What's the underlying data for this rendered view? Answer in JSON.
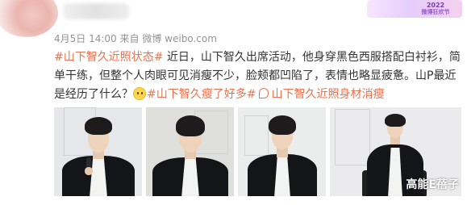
{
  "header": {
    "badge_line1": "2022",
    "badge_line2": "微博狂欢节"
  },
  "meta": {
    "date": "4月5日",
    "time": "14:00",
    "source": "来自 微博 weibo.com"
  },
  "post": {
    "tag_main": "#山下智久近照状态#",
    "text_part1": " 近日，山下智久出席活动，他身穿黑色西服搭配白衬衫，简",
    "text_line2": "单干练，但整个人肉眼可见消瘦不少，脸颊都凹陷了，表情也略显疲惫。山P最近",
    "text_line3_start": "是经历了什么？",
    "tag_thin": "#山下智久瘦了好多#",
    "topic_link": "山下智久近照身材消瘦"
  },
  "watermark": "高能E蓓子",
  "icons": {
    "emoji": "thinking-face-icon",
    "topic": "super-topic-icon",
    "chevron": "chevron-down-icon"
  },
  "colors": {
    "tag": "#eb7350",
    "meta": "#939393",
    "text": "#333333"
  }
}
